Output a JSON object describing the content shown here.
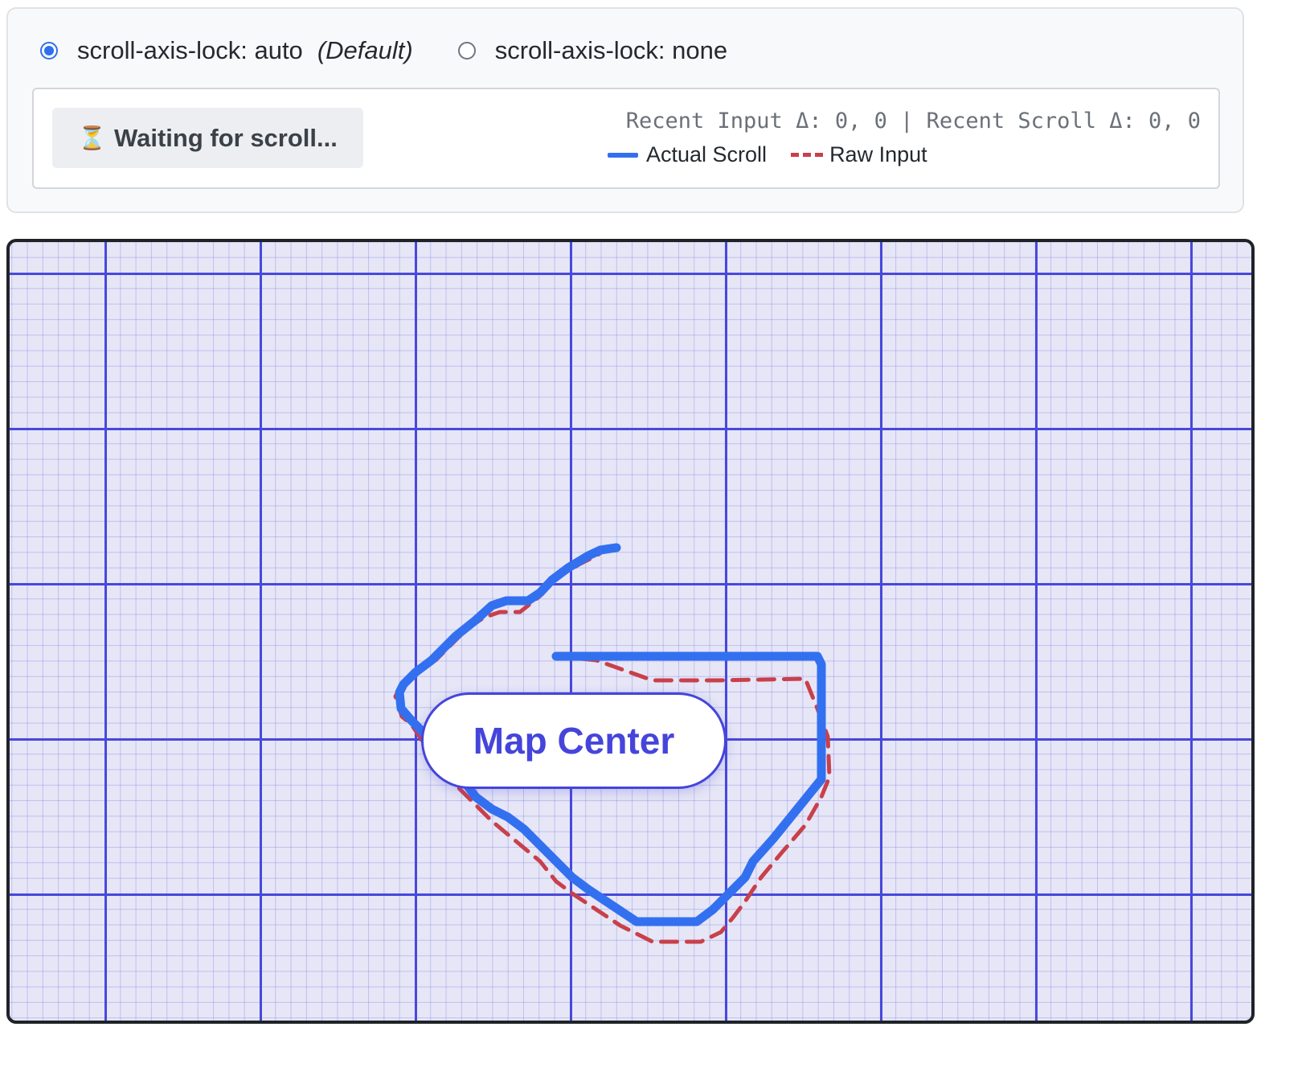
{
  "controls": {
    "options": [
      {
        "label": "scroll-axis-lock: auto",
        "note": "(Default)",
        "checked": true
      },
      {
        "label": "scroll-axis-lock: none",
        "checked": false
      }
    ]
  },
  "status": {
    "icon": "hourglass-icon",
    "badge_text": "Waiting for scroll...",
    "readout": "Recent Input Δ: 0, 0 | Recent Scroll Δ: 0, 0"
  },
  "legend": [
    {
      "label": "Actual Scroll",
      "color": "#3370f0",
      "style": "solid"
    },
    {
      "label": "Raw Input",
      "color": "#c9404a",
      "style": "dashed"
    }
  ],
  "map": {
    "center_label": "Map Center",
    "grid_color": "#4848dc",
    "background": "#e6e6f6"
  }
}
